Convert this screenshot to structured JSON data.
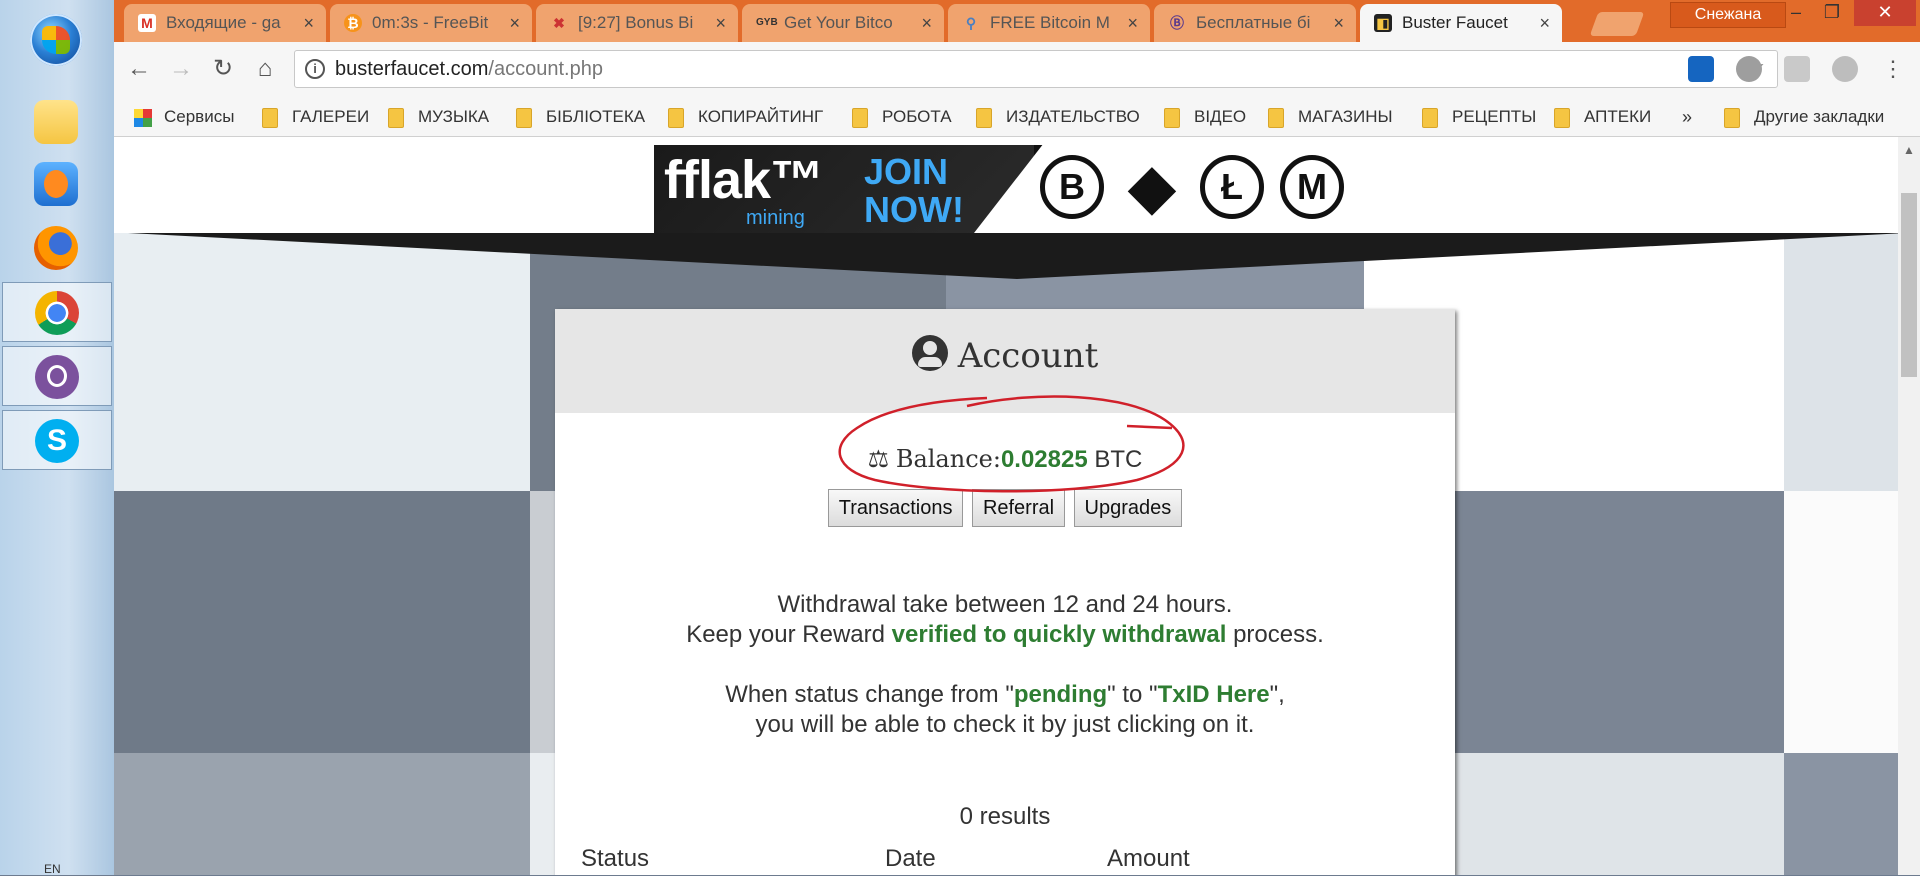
{
  "taskbar": {
    "language": "EN",
    "apps": [
      {
        "name": "file-explorer-icon",
        "color": "#f5c542"
      },
      {
        "name": "media-player-icon",
        "color": "#ff8a1f"
      },
      {
        "name": "firefox-icon",
        "color": "#e66000"
      },
      {
        "name": "chrome-icon",
        "color": "#4285f4"
      },
      {
        "name": "viber-icon",
        "color": "#7b519d"
      },
      {
        "name": "skype-icon",
        "color": "#00aff0"
      }
    ]
  },
  "browser": {
    "tabs": [
      {
        "label": "Входящие - ga",
        "icon": "gmail-icon"
      },
      {
        "label": "0m:3s - FreeBit",
        "icon": "bitcoin-icon"
      },
      {
        "label": "[9:27] Bonus Bi",
        "icon": "bonus-icon"
      },
      {
        "label": "Get Your Bitco",
        "icon": "gyb-icon"
      },
      {
        "label": "FREE Bitcoin M",
        "icon": "faucet-icon"
      },
      {
        "label": "Бесплатные бі",
        "icon": "b-icon"
      },
      {
        "label": "Buster Faucet",
        "icon": "buster-icon"
      }
    ],
    "user": "Снежана",
    "url_host": "busterfaucet.com",
    "url_path": "/account.php",
    "bookmarks": [
      "Сервисы",
      "ГАЛЕРЕИ",
      "МУЗЫКА",
      "БІБЛІОТЕКА",
      "КОПИРАЙТИНГ",
      "РОБОТА",
      "ИЗДАТЕЛЬСТВО",
      "ВІДЕО",
      "МАГАЗИНЫ",
      "РЕЦЕПТЫ",
      "АПТЕКИ"
    ],
    "overflow": "»",
    "other_bookmarks": "Другие закладки"
  },
  "banner": {
    "logo": "fflak™",
    "sub": "mining",
    "cta_line1": "JOIN",
    "cta_line2": "NOW!",
    "coins": [
      "B",
      "◆",
      "Ł",
      "M"
    ]
  },
  "account": {
    "title": "Account",
    "balance_label": "Balance:",
    "balance_value": "0.02825",
    "balance_unit": "BTC",
    "buttons": [
      "Transactions",
      "Referral",
      "Upgrades"
    ],
    "line1": "Withdrawal take between 12 and 24 hours.",
    "line2_pre": "Keep your Reward ",
    "line2_link": "verified to quickly withdrawal",
    "line2_post": " process.",
    "line3_pre": "When status change from \"",
    "line3_a": "pending",
    "line3_mid": "\" to \"",
    "line3_b": "TxID Here",
    "line3_post": "\",",
    "line4": "you will be able to check it by just clicking on it.",
    "results": "0 results",
    "columns": [
      "Status",
      "Date",
      "Amount"
    ]
  },
  "colors": {
    "chrome_orange": "#e26b2a",
    "accent_green": "#2e7d32",
    "annotation_red": "#d0202a"
  }
}
